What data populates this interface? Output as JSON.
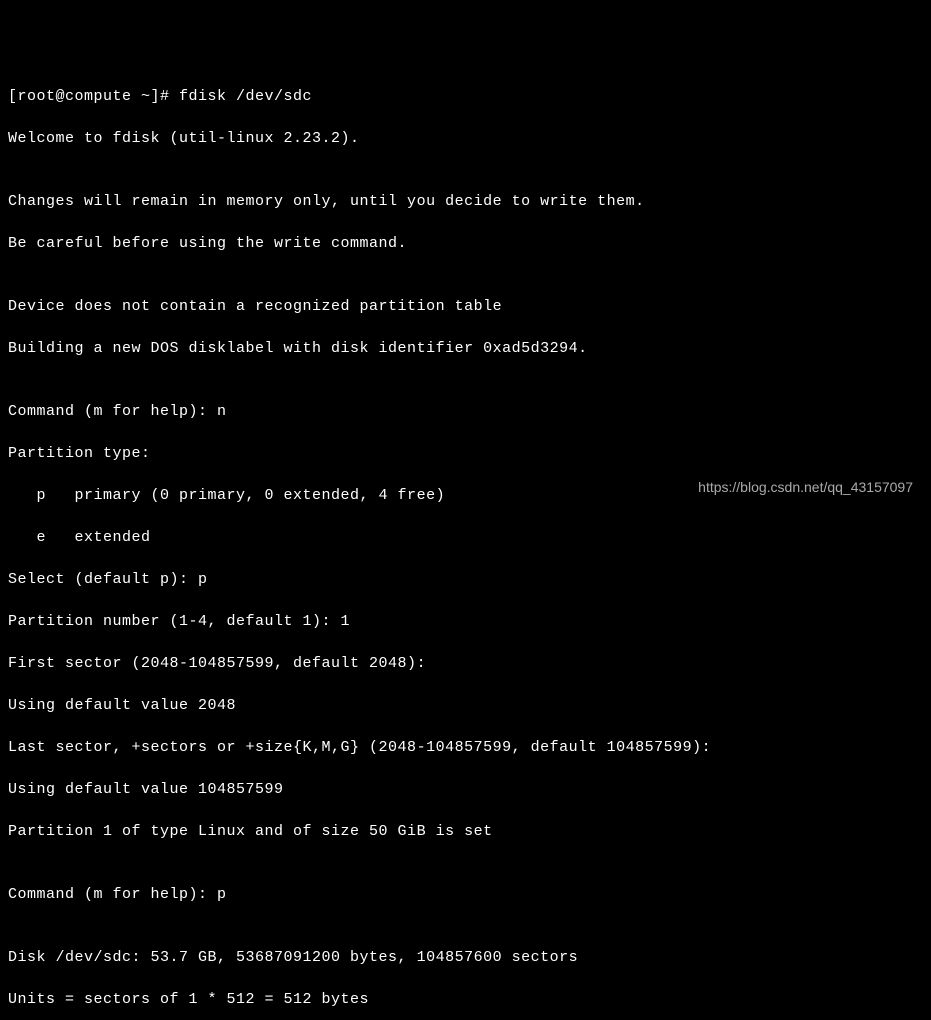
{
  "lines": {
    "l0": "[root@compute ~]# fdisk /dev/sdc",
    "l1": "Welcome to fdisk (util-linux 2.23.2).",
    "l2": "",
    "l3": "Changes will remain in memory only, until you decide to write them.",
    "l4": "Be careful before using the write command.",
    "l5": "",
    "l6": "Device does not contain a recognized partition table",
    "l7": "Building a new DOS disklabel with disk identifier 0xad5d3294.",
    "l8": "",
    "l9": "Command (m for help): n",
    "l10": "Partition type:",
    "l11": "   p   primary (0 primary, 0 extended, 4 free)",
    "l12": "   e   extended",
    "l13": "Select (default p): p",
    "l14": "Partition number (1-4, default 1): 1",
    "l15": "First sector (2048-104857599, default 2048):",
    "l16": "Using default value 2048",
    "l17": "Last sector, +sectors or +size{K,M,G} (2048-104857599, default 104857599):",
    "l18": "Using default value 104857599",
    "l19": "Partition 1 of type Linux and of size 50 GiB is set",
    "l20": "",
    "l21": "Command (m for help): p",
    "l22": "",
    "l23": "Disk /dev/sdc: 53.7 GB, 53687091200 bytes, 104857600 sectors",
    "l24": "Units = sectors of 1 * 512 = 512 bytes"
  },
  "watermark": "https://blog.csdn.net/qq_43157097"
}
